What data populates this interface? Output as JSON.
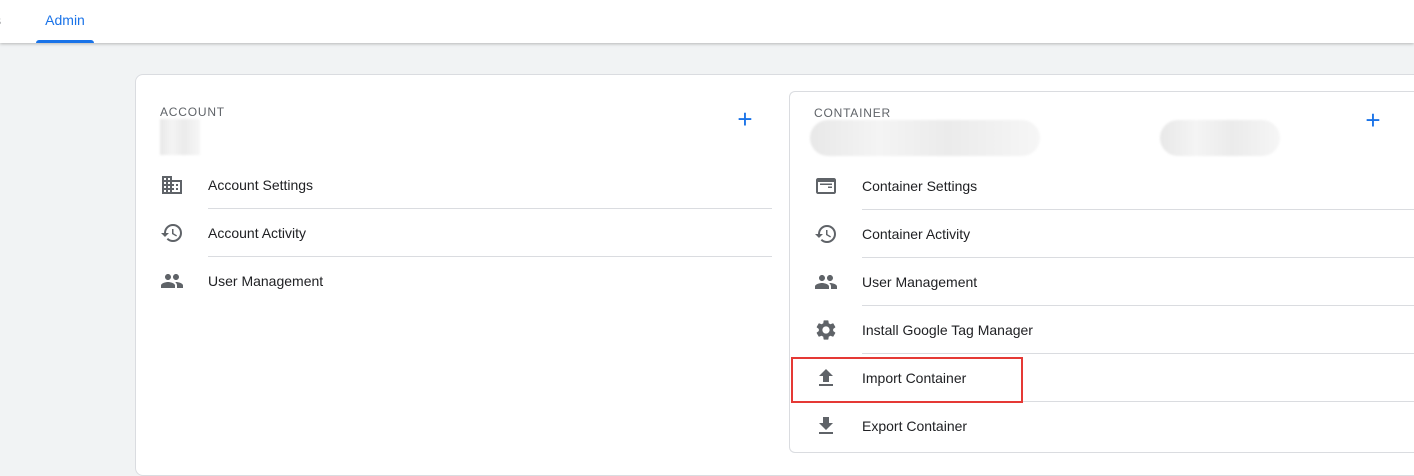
{
  "topbar": {
    "partial_tab_label": "s",
    "admin_tab_label": "Admin"
  },
  "account": {
    "section_label": "ACCOUNT",
    "items": [
      {
        "label": "Account Settings",
        "icon": "building-icon"
      },
      {
        "label": "Account Activity",
        "icon": "history-icon"
      },
      {
        "label": "User Management",
        "icon": "people-icon"
      }
    ]
  },
  "container": {
    "section_label": "CONTAINER",
    "items": [
      {
        "label": "Container Settings",
        "icon": "web-window-icon"
      },
      {
        "label": "Container Activity",
        "icon": "history-icon"
      },
      {
        "label": "User Management",
        "icon": "people-icon"
      },
      {
        "label": "Install Google Tag Manager",
        "icon": "gear-icon"
      },
      {
        "label": "Import Container",
        "icon": "upload-icon"
      },
      {
        "label": "Export Container",
        "icon": "download-icon"
      }
    ]
  },
  "colors": {
    "accent": "#1a73e8",
    "highlight": "#e53935",
    "icon": "#5f6368"
  }
}
